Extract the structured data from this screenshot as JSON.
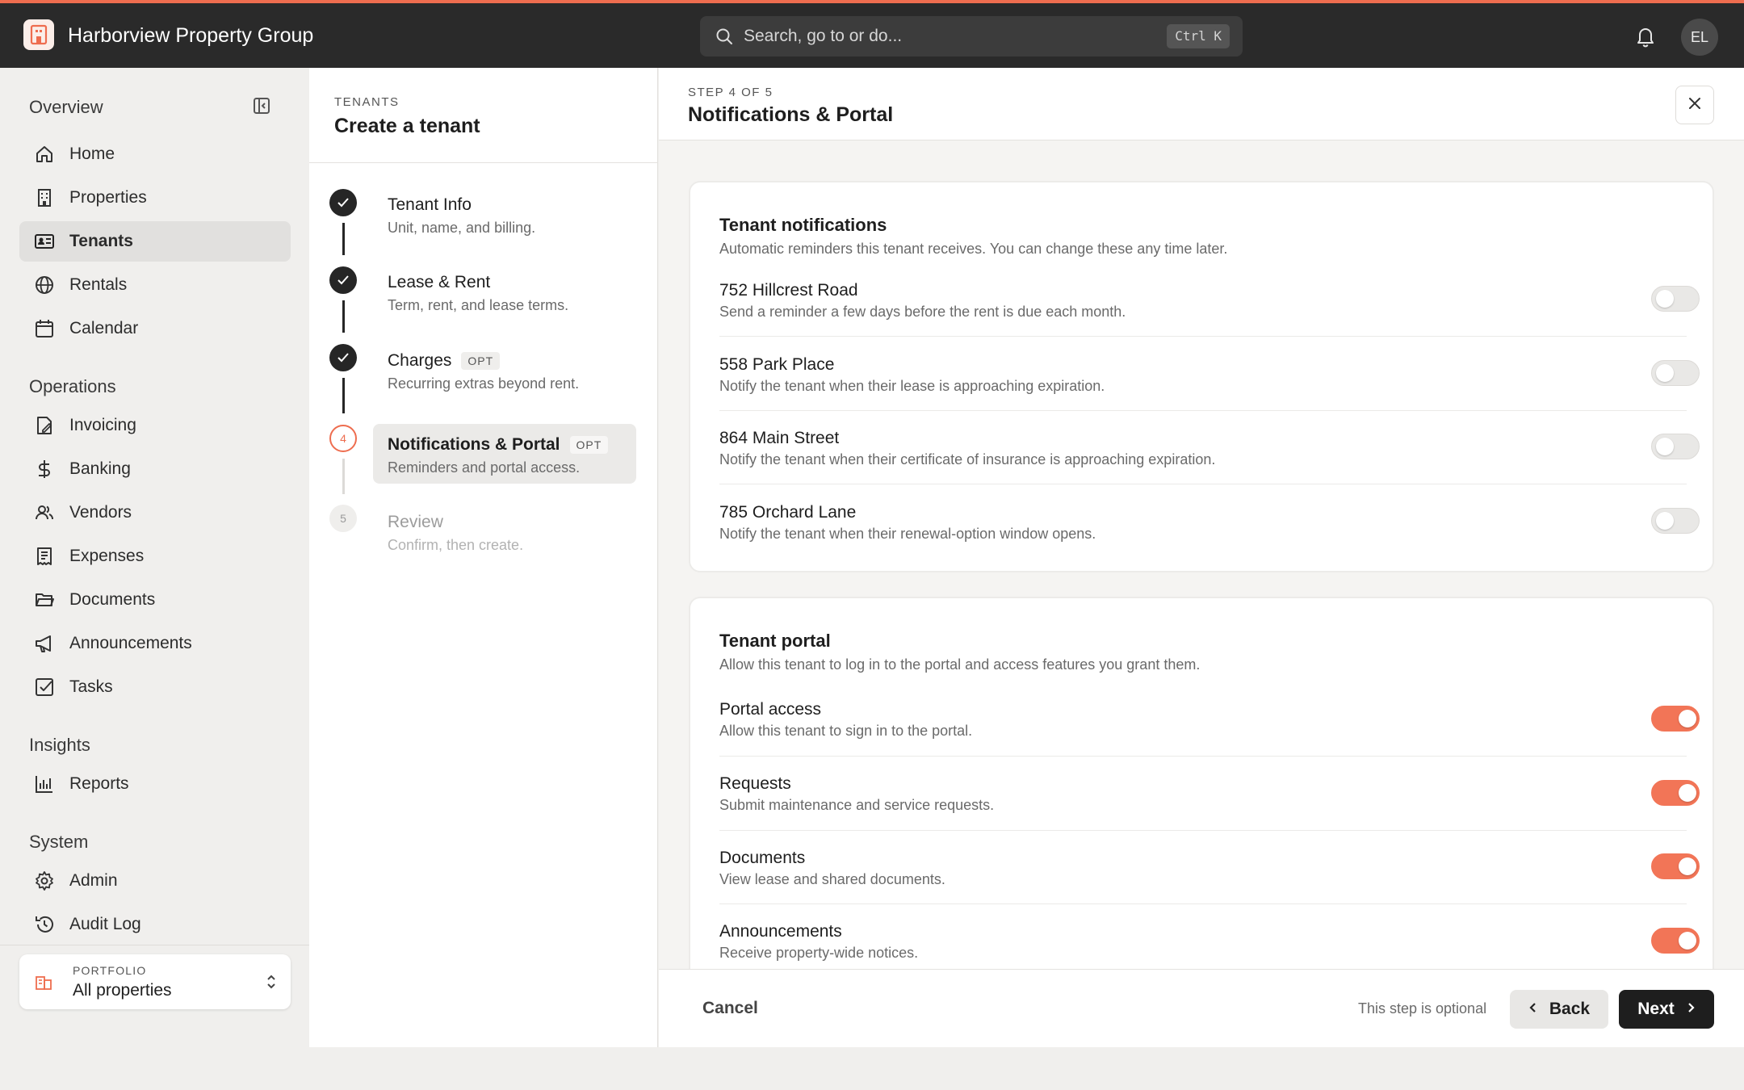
{
  "app": {
    "company": "Harborview Property Group",
    "search_placeholder": "Search, go to or do...",
    "search_shortcut": "Ctrl K",
    "avatar_initials": "EL",
    "accent_color": "#ee6d4f"
  },
  "sidebar": {
    "sections": {
      "overview": "Overview",
      "operations": "Operations",
      "insights": "Insights",
      "system": "System"
    },
    "items": [
      {
        "label": "Home",
        "icon": "home-icon"
      },
      {
        "label": "Properties",
        "icon": "building-icon"
      },
      {
        "label": "Tenants",
        "icon": "id-card-icon",
        "active": true
      },
      {
        "label": "Rentals",
        "icon": "globe-icon"
      },
      {
        "label": "Calendar",
        "icon": "calendar-icon"
      },
      {
        "label": "Invoicing",
        "icon": "invoice-icon"
      },
      {
        "label": "Banking",
        "icon": "dollar-icon"
      },
      {
        "label": "Vendors",
        "icon": "users-icon"
      },
      {
        "label": "Expenses",
        "icon": "receipt-icon"
      },
      {
        "label": "Documents",
        "icon": "folder-icon"
      },
      {
        "label": "Announcements",
        "icon": "megaphone-icon"
      },
      {
        "label": "Tasks",
        "icon": "checkbox-icon"
      },
      {
        "label": "Reports",
        "icon": "bar-chart-icon"
      },
      {
        "label": "Admin",
        "icon": "gear-icon"
      },
      {
        "label": "Audit Log",
        "icon": "history-icon"
      }
    ],
    "portfolio": {
      "label": "PORTFOLIO",
      "value": "All properties"
    }
  },
  "wizard": {
    "eyebrow": "TENANTS",
    "title": "Create a tenant",
    "steps": [
      {
        "number": "1",
        "name": "Tenant Info",
        "desc": "Unit, name, and billing.",
        "state": "done"
      },
      {
        "number": "2",
        "name": "Lease & Rent",
        "desc": "Term, rent, and lease terms.",
        "state": "done"
      },
      {
        "number": "3",
        "name": "Charges",
        "badge": "OPT",
        "desc": "Recurring extras beyond rent.",
        "state": "done"
      },
      {
        "number": "4",
        "name": "Notifications & Portal",
        "badge": "OPT",
        "desc": "Reminders and portal access.",
        "state": "current"
      },
      {
        "number": "5",
        "name": "Review",
        "desc": "Confirm, then create.",
        "state": "todo"
      }
    ]
  },
  "main": {
    "eyebrow": "STEP 4 OF 5",
    "title": "Notifications & Portal",
    "notifications": {
      "title": "Tenant notifications",
      "subtitle": "Automatic reminders this tenant receives. You can change these any time later.",
      "rows": [
        {
          "title": "752 Hillcrest Road",
          "desc": "Send a reminder a few days before the rent is due each month.",
          "on": false
        },
        {
          "title": "558 Park Place",
          "desc": "Notify the tenant when their lease is approaching expiration.",
          "on": false
        },
        {
          "title": "864 Main Street",
          "desc": "Notify the tenant when their certificate of insurance is approaching expiration.",
          "on": false
        },
        {
          "title": "785 Orchard Lane",
          "desc": "Notify the tenant when their renewal-option window opens.",
          "on": false
        }
      ]
    },
    "portal": {
      "title": "Tenant portal",
      "subtitle": "Allow this tenant to log in to the portal and access features you grant them.",
      "rows": [
        {
          "title": "Portal access",
          "desc": "Allow this tenant to sign in to the portal.",
          "on": true
        },
        {
          "title": "Requests",
          "desc": "Submit maintenance and service requests.",
          "on": true
        },
        {
          "title": "Documents",
          "desc": "View lease and shared documents.",
          "on": true
        },
        {
          "title": "Announcements",
          "desc": "Receive property-wide notices.",
          "on": true
        }
      ]
    },
    "footer": {
      "cancel": "Cancel",
      "optional_note": "This step is optional",
      "back": "Back",
      "next": "Next"
    }
  }
}
